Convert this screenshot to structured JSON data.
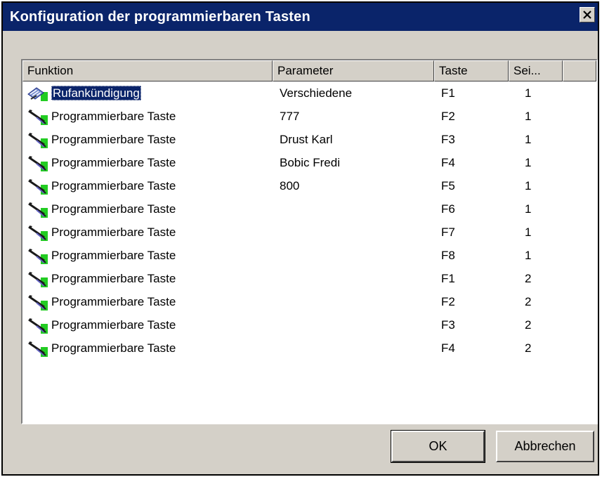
{
  "dialog": {
    "title": "Konfiguration der programmierbaren Tasten",
    "close_glyph": "✕"
  },
  "list": {
    "columns": [
      "Funktion",
      "Parameter",
      "Taste",
      "Sei..."
    ],
    "rows": [
      {
        "icon": "call-announcement-icon",
        "function": "Rufankündigung",
        "parameter": "Verschiedene",
        "key": "F1",
        "page": "1",
        "selected": true
      },
      {
        "icon": "programmable-key-icon",
        "function": "Programmierbare Taste",
        "parameter": "777",
        "key": "F2",
        "page": "1"
      },
      {
        "icon": "programmable-key-icon",
        "function": "Programmierbare Taste",
        "parameter": "Drust Karl",
        "key": "F3",
        "page": "1"
      },
      {
        "icon": "programmable-key-icon",
        "function": "Programmierbare Taste",
        "parameter": "Bobic Fredi",
        "key": "F4",
        "page": "1"
      },
      {
        "icon": "programmable-key-icon",
        "function": "Programmierbare Taste",
        "parameter": "800",
        "key": "F5",
        "page": "1"
      },
      {
        "icon": "programmable-key-icon",
        "function": "Programmierbare Taste",
        "parameter": "",
        "key": "F6",
        "page": "1"
      },
      {
        "icon": "programmable-key-icon",
        "function": "Programmierbare Taste",
        "parameter": "",
        "key": "F7",
        "page": "1"
      },
      {
        "icon": "programmable-key-icon",
        "function": "Programmierbare Taste",
        "parameter": "",
        "key": "F8",
        "page": "1"
      },
      {
        "icon": "programmable-key-icon",
        "function": "Programmierbare Taste",
        "parameter": "",
        "key": "F1",
        "page": "2"
      },
      {
        "icon": "programmable-key-icon",
        "function": "Programmierbare Taste",
        "parameter": "",
        "key": "F2",
        "page": "2"
      },
      {
        "icon": "programmable-key-icon",
        "function": "Programmierbare Taste",
        "parameter": "",
        "key": "F3",
        "page": "2"
      },
      {
        "icon": "programmable-key-icon",
        "function": "Programmierbare Taste",
        "parameter": "",
        "key": "F4",
        "page": "2"
      }
    ]
  },
  "buttons": {
    "ok": "OK",
    "cancel": "Abbrechen"
  },
  "colors": {
    "titlebar": "#0a246a",
    "face": "#d4d0c8",
    "icon_green": "#22cc22"
  }
}
